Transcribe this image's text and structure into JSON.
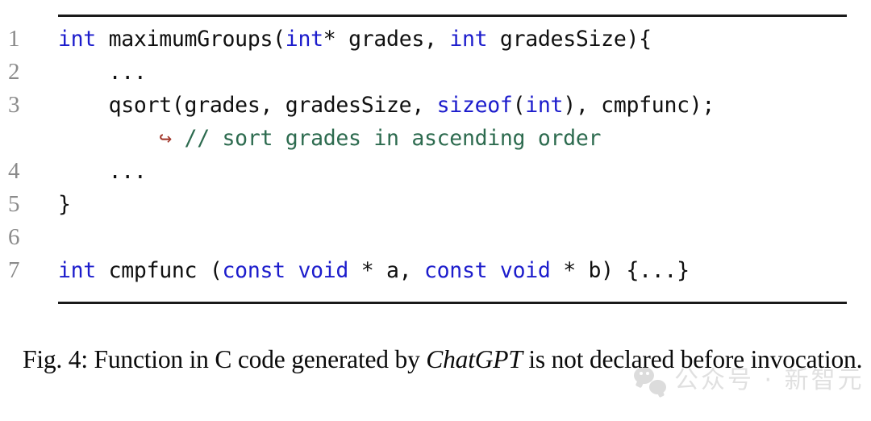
{
  "figure": {
    "rule_color": "#1a1a1a",
    "code": {
      "language": "C",
      "colors": {
        "keyword": "#1c1ccc",
        "comment": "#2d6b4f",
        "continuation_arrow": "#a33a2e",
        "plain": "#101010",
        "line_number": "#8a8a8a"
      },
      "lines": [
        {
          "number": "1",
          "tokens": [
            {
              "t": "int",
              "c": "kw"
            },
            {
              "t": " maximumGroups(",
              "c": "plain"
            },
            {
              "t": "int",
              "c": "kw"
            },
            {
              "t": "* grades, ",
              "c": "plain"
            },
            {
              "t": "int",
              "c": "kw"
            },
            {
              "t": " gradesSize){",
              "c": "plain"
            }
          ]
        },
        {
          "number": "2",
          "tokens": [
            {
              "t": "    ...",
              "c": "plain"
            }
          ]
        },
        {
          "number": "3",
          "tokens": [
            {
              "t": "    qsort(grades, gradesSize, ",
              "c": "plain"
            },
            {
              "t": "sizeof",
              "c": "kw"
            },
            {
              "t": "(",
              "c": "plain"
            },
            {
              "t": "int",
              "c": "kw"
            },
            {
              "t": "), cmpfunc);",
              "c": "plain"
            }
          ]
        },
        {
          "number": "",
          "continuation": true,
          "tokens": [
            {
              "t": "        ↪ ",
              "c": "arrow"
            },
            {
              "t": "// sort grades in ascending order",
              "c": "cmt"
            }
          ]
        },
        {
          "number": "4",
          "tokens": [
            {
              "t": "    ...",
              "c": "plain"
            }
          ]
        },
        {
          "number": "5",
          "tokens": [
            {
              "t": "}",
              "c": "plain"
            }
          ]
        },
        {
          "number": "6",
          "tokens": [
            {
              "t": "",
              "c": "plain"
            }
          ]
        },
        {
          "number": "7",
          "tokens": [
            {
              "t": "int",
              "c": "kw"
            },
            {
              "t": " cmpfunc (",
              "c": "plain"
            },
            {
              "t": "const void",
              "c": "kw"
            },
            {
              "t": " * a, ",
              "c": "plain"
            },
            {
              "t": "const void",
              "c": "kw"
            },
            {
              "t": " * b) {...}",
              "c": "plain"
            }
          ]
        }
      ]
    },
    "caption": {
      "label": "Fig. 4:",
      "text_before_italic": " Function in C code generated by ",
      "italic_term": "ChatGPT",
      "text_after_italic": " is not declared before invocation.",
      "full": "Fig. 4: Function in C code generated by ChatGPT is not declared before invocation."
    }
  },
  "watermark": {
    "logo_icon": "wechat-icon",
    "text": "公众号 · 新智元",
    "color": "#9a9a9a"
  }
}
